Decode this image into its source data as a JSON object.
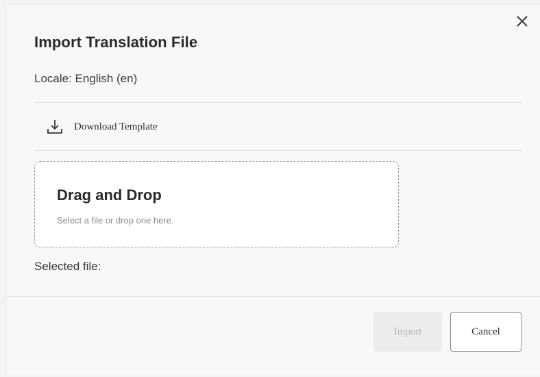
{
  "dialog": {
    "title": "Import Translation File",
    "locale_label": "Locale: English (en)",
    "download_label": "Download Template",
    "dropzone": {
      "title": "Drag and Drop",
      "subtitle": "Select a file or drop one here."
    },
    "selected_file_label": "Selected file:",
    "buttons": {
      "import_label": "Import",
      "cancel_label": "Cancel"
    },
    "icons": {
      "close": "close-icon",
      "download": "download-icon"
    }
  },
  "colors": {
    "background": "#f8f8f8",
    "text": "#2a2a2a",
    "muted": "#8a8a8a",
    "disabled_bg": "#ececec",
    "disabled_text": "#b3b3b3"
  }
}
